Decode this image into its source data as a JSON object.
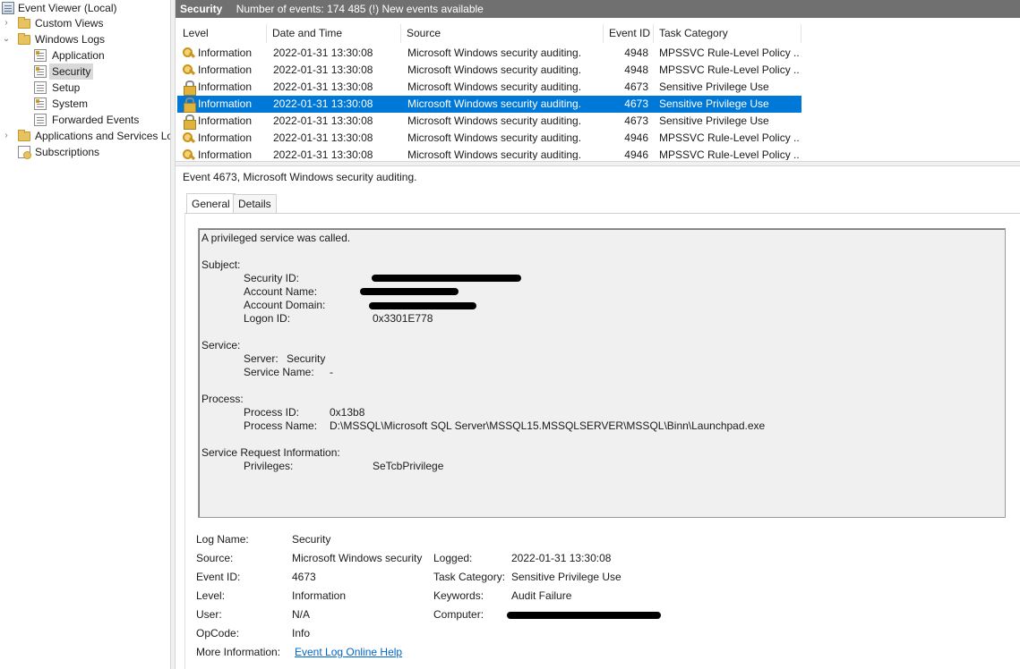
{
  "tree": {
    "root": "Event Viewer (Local)",
    "custom_views": "Custom Views",
    "windows_logs": "Windows Logs",
    "application": "Application",
    "security": "Security",
    "setup": "Setup",
    "system": "System",
    "forwarded_events": "Forwarded Events",
    "apps_services": "Applications and Services Lo",
    "subscriptions": "Subscriptions",
    "expand_glyph": "›",
    "collapse_glyph": "⌄"
  },
  "header": {
    "title": "Security",
    "info": "Number of events: 174 485 (!) New events available"
  },
  "grid": {
    "columns": [
      "Level",
      "Date and Time",
      "Source",
      "Event ID",
      "Task Category"
    ],
    "rows": [
      {
        "icon": "key-icon",
        "level": "Information",
        "datetime": "2022-01-31 13:30:08",
        "source": "Microsoft Windows security auditing.",
        "event_id": "4948",
        "category": "MPSSVC Rule-Level Policy ..."
      },
      {
        "icon": "key-icon",
        "level": "Information",
        "datetime": "2022-01-31 13:30:08",
        "source": "Microsoft Windows security auditing.",
        "event_id": "4948",
        "category": "MPSSVC Rule-Level Policy ..."
      },
      {
        "icon": "lock-icon",
        "level": "Information",
        "datetime": "2022-01-31 13:30:08",
        "source": "Microsoft Windows security auditing.",
        "event_id": "4673",
        "category": "Sensitive Privilege Use"
      },
      {
        "icon": "lock-icon",
        "level": "Information",
        "datetime": "2022-01-31 13:30:08",
        "source": "Microsoft Windows security auditing.",
        "event_id": "4673",
        "category": "Sensitive Privilege Use"
      },
      {
        "icon": "lock-icon",
        "level": "Information",
        "datetime": "2022-01-31 13:30:08",
        "source": "Microsoft Windows security auditing.",
        "event_id": "4673",
        "category": "Sensitive Privilege Use"
      },
      {
        "icon": "key-icon",
        "level": "Information",
        "datetime": "2022-01-31 13:30:08",
        "source": "Microsoft Windows security auditing.",
        "event_id": "4946",
        "category": "MPSSVC Rule-Level Policy ..."
      },
      {
        "icon": "key-icon",
        "level": "Information",
        "datetime": "2022-01-31 13:30:08",
        "source": "Microsoft Windows security auditing.",
        "event_id": "4946",
        "category": "MPSSVC Rule-Level Policy ..."
      }
    ]
  },
  "preview": {
    "title": "Event 4673, Microsoft Windows security auditing.",
    "tabs": [
      "General",
      "Details"
    ],
    "description": {
      "headline": "A privileged service was called.",
      "subject": "Subject:",
      "security_id_label": "Security ID:",
      "account_name_label": "Account Name:",
      "account_domain_label": "Account Domain:",
      "logon_id_label": "Logon ID:",
      "logon_id_value": "0x3301E778",
      "service": "Service:",
      "server_label": "Server:",
      "server_value": "Security",
      "service_name_label": "Service Name:",
      "service_name_value": "-",
      "process": "Process:",
      "process_id_label": "Process ID:",
      "process_id_value": "0x13b8",
      "process_name_label": "Process Name:",
      "process_name_value": "D:\\MSSQL\\Microsoft SQL Server\\MSSQL15.MSSQLSERVER\\MSSQL\\Binn\\Launchpad.exe",
      "sri": "Service Request Information:",
      "privileges_label": "Privileges:",
      "privileges_value": "SeTcbPrivilege"
    },
    "meta": {
      "log_name_label": "Log Name:",
      "log_name_value": "Security",
      "source_label": "Source:",
      "source_value": "Microsoft Windows security",
      "logged_label": "Logged:",
      "logged_value": "2022-01-31 13:30:08",
      "event_id_label": "Event ID:",
      "event_id_value": "4673",
      "task_category_label": "Task Category:",
      "task_category_value": "Sensitive Privilege Use",
      "level_label": "Level:",
      "level_value": "Information",
      "keywords_label": "Keywords:",
      "keywords_value": "Audit Failure",
      "user_label": "User:",
      "user_value": "N/A",
      "computer_label": "Computer:",
      "opcode_label": "OpCode:",
      "opcode_value": "Info",
      "more_info_label": "More Information:",
      "more_info_link": "Event Log Online Help"
    }
  },
  "colors": {
    "header_bg": "#707070",
    "selection": "#0078d7",
    "link": "#0066cc"
  }
}
